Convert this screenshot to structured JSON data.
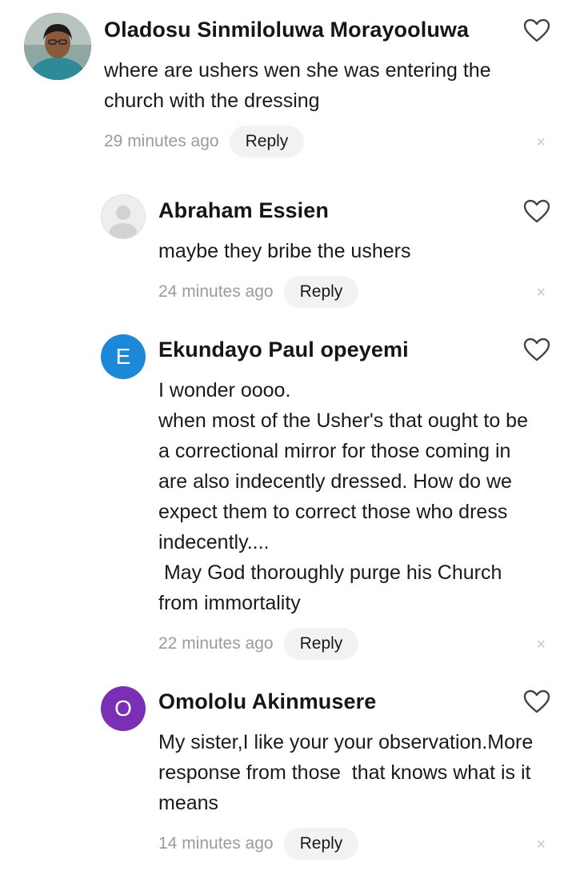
{
  "comments": [
    {
      "author": "Oladosu Sinmiloluwa Morayooluwa",
      "avatar": {
        "type": "photo"
      },
      "text": "where are ushers wen she was entering the\nchurch with the dressing",
      "time": "29 minutes ago",
      "reply_label": "Reply",
      "close_glyph": "×",
      "like_icon": "heart-outline-icon"
    },
    {
      "author": "Abraham Essien",
      "avatar": {
        "type": "default-person"
      },
      "text": "maybe they bribe the ushers",
      "time": "24 minutes ago",
      "reply_label": "Reply",
      "close_glyph": "×",
      "like_icon": "heart-outline-icon"
    },
    {
      "author": "Ekundayo Paul opeyemi",
      "avatar": {
        "type": "letter",
        "letter": "E",
        "color": "#1e88d8"
      },
      "text": "I wonder oooo.\nwhen most of the Usher's that ought to be\na correctional mirror for those coming in\nare also indecently dressed. How do we\nexpect them to correct those who dress\nindecently....\n May God thoroughly purge his Church\nfrom immortality",
      "time": "22 minutes ago",
      "reply_label": "Reply",
      "close_glyph": "×",
      "like_icon": "heart-outline-icon"
    },
    {
      "author": "Omololu Akinmusere",
      "avatar": {
        "type": "letter",
        "letter": "O",
        "color": "#7b2fb5"
      },
      "text": "My sister,I like your your observation.More\nresponse from those  that knows what is it\nmeans",
      "time": "14 minutes ago",
      "reply_label": "Reply",
      "close_glyph": "×",
      "like_icon": "heart-outline-icon"
    }
  ]
}
